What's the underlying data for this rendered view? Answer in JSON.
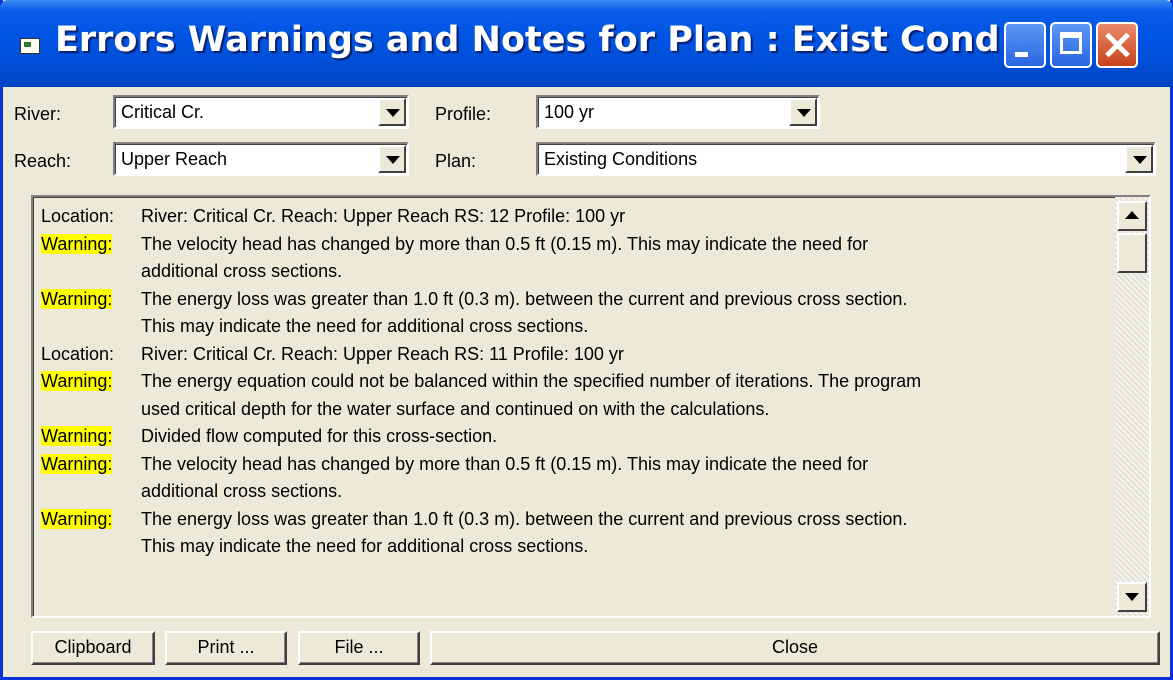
{
  "window": {
    "title": "Errors Warnings and Notes for Plan : Exist Cond",
    "icons": [
      "app-icon",
      "minimize-icon",
      "maximize-icon",
      "close-icon"
    ]
  },
  "filters": {
    "river_label": "River:",
    "river_value": "Critical Cr.",
    "reach_label": "Reach:",
    "reach_value": "Upper Reach",
    "profile_label": "Profile:",
    "profile_value": "100 yr",
    "plan_label": "Plan:",
    "plan_value": "Existing Conditions"
  },
  "messages": [
    {
      "tag": "Location:",
      "text": "River: Critical Cr.  Reach: Upper Reach     RS: 12     Profile: 100 yr",
      "highlight": false
    },
    {
      "tag": "Warning:",
      "text": "The velocity head has changed by more than 0.5 ft (0.15 m).  This may indicate the need for",
      "highlight": true
    },
    {
      "tag": "",
      "text": "additional cross sections.",
      "highlight": false
    },
    {
      "tag": "Warning:",
      "text": "The energy loss was greater than 1.0 ft (0.3 m). between the current and previous cross section.",
      "highlight": true
    },
    {
      "tag": "",
      "text": "This may indicate the need for additional cross sections.",
      "highlight": false
    },
    {
      "tag": "Location:",
      "text": "River: Critical Cr.  Reach: Upper Reach     RS: 11     Profile: 100 yr",
      "highlight": false
    },
    {
      "tag": "Warning:",
      "text": "The energy equation could not be balanced within the specified number of iterations.  The program",
      "highlight": true
    },
    {
      "tag": "",
      "text": "used critical depth for the water surface and continued on with the calculations.",
      "highlight": false
    },
    {
      "tag": "Warning:",
      "text": "Divided flow computed for this cross-section.",
      "highlight": true
    },
    {
      "tag": "Warning:",
      "text": "The velocity head has changed by more than 0.5 ft (0.15 m).  This may indicate the need for",
      "highlight": true
    },
    {
      "tag": "",
      "text": "additional cross sections.",
      "highlight": false
    },
    {
      "tag": "Warning:",
      "text": "The energy loss was greater than 1.0 ft (0.3 m). between the current and previous cross section.",
      "highlight": true
    },
    {
      "tag": "",
      "text": "This may indicate the need for additional cross sections.",
      "highlight": false
    }
  ],
  "buttons": {
    "clipboard": "Clipboard",
    "print": "Print ...",
    "file": "File ...",
    "close": "Close"
  },
  "colors": {
    "warning_highlight": "#ffff00",
    "titlebar": "#0054e3",
    "dialog_face": "#ece9d8"
  }
}
